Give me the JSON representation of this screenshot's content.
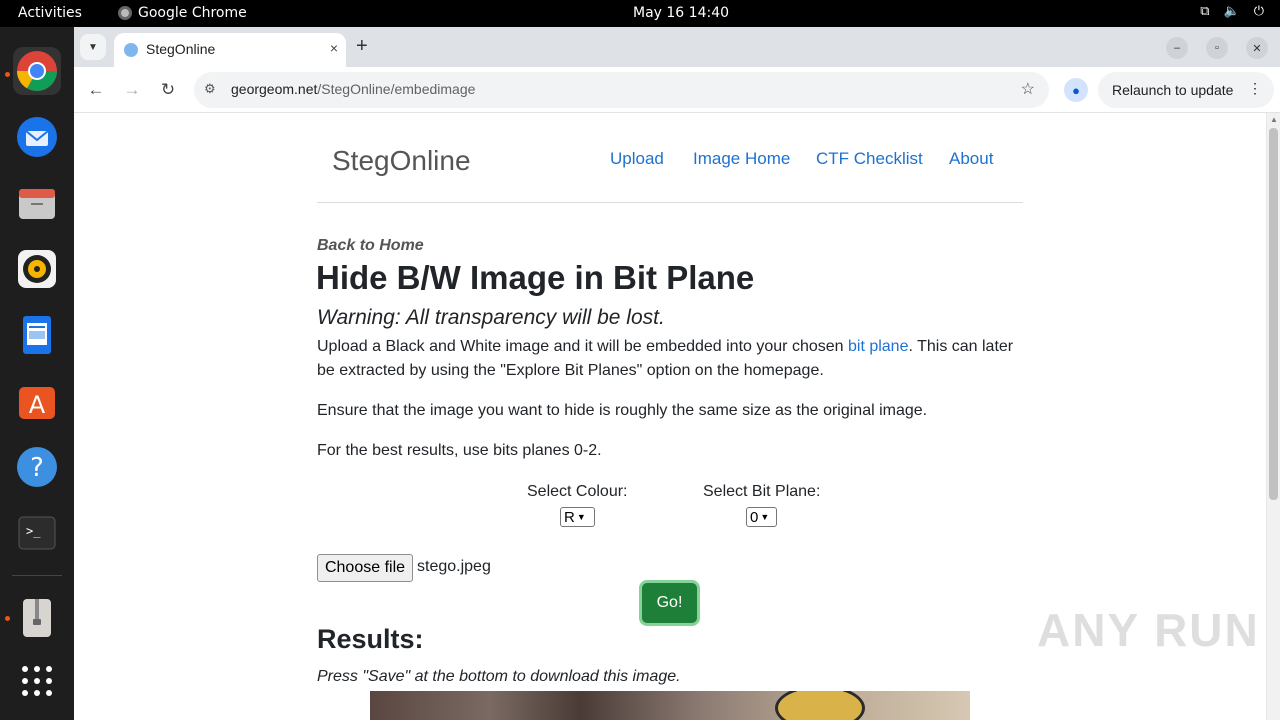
{
  "system": {
    "activities": "Activities",
    "app_name": "Google Chrome",
    "clock": "May 16  14:40",
    "tray_icons": [
      "network-icon",
      "volume-icon",
      "power-icon"
    ]
  },
  "dock": {
    "items": [
      "chrome-icon",
      "thunderbird-icon",
      "files-icon",
      "rhythmbox-icon",
      "writer-icon",
      "app-center-icon",
      "help-icon",
      "terminal-icon",
      "archive-icon",
      "apps-grid-icon"
    ]
  },
  "browser": {
    "tab_title": "StegOnline",
    "tab_close": "×",
    "new_tab": "+",
    "url_host": "georgeom.net",
    "url_path": "/StegOnline/embedimage",
    "relaunch_label": "Relaunch to update",
    "relaunch_more": "⋮",
    "window_controls": {
      "minimize": "–",
      "restore": "▫",
      "close": "✕"
    }
  },
  "site": {
    "brand": "StegOnline",
    "nav": [
      "Upload",
      "Image Home",
      "CTF Checklist",
      "About"
    ]
  },
  "page": {
    "back_link": "Back to Home",
    "title": "Hide B/W Image in Bit Plane",
    "warning": "Warning: All transparency will be lost.",
    "intro_before": "Upload a Black and White image and it will be embedded into your chosen ",
    "intro_link": "bit plane",
    "intro_after": ". This can later be extracted by using the \"Explore Bit Planes\" option on the homepage.",
    "size_note": "Ensure that the image you want to hide is roughly the same size as the original image.",
    "best_note": "For the best results, use bits planes 0-2.",
    "colour_label": "Select Colour:",
    "colour_value": "R",
    "bitplane_label": "Select Bit Plane:",
    "bitplane_value": "0",
    "file_button": "Choose file",
    "file_name": "stego.jpeg",
    "go_button": "Go!",
    "results_heading": "Results:",
    "save_hint": "Press \"Save\" at the bottom to download this image."
  },
  "watermark": "ANY RUN",
  "colors": {
    "link": "#1d72d0",
    "go_button": "#1e8038",
    "dock_bg": "#1e1e1e",
    "accent": "#e95420"
  }
}
